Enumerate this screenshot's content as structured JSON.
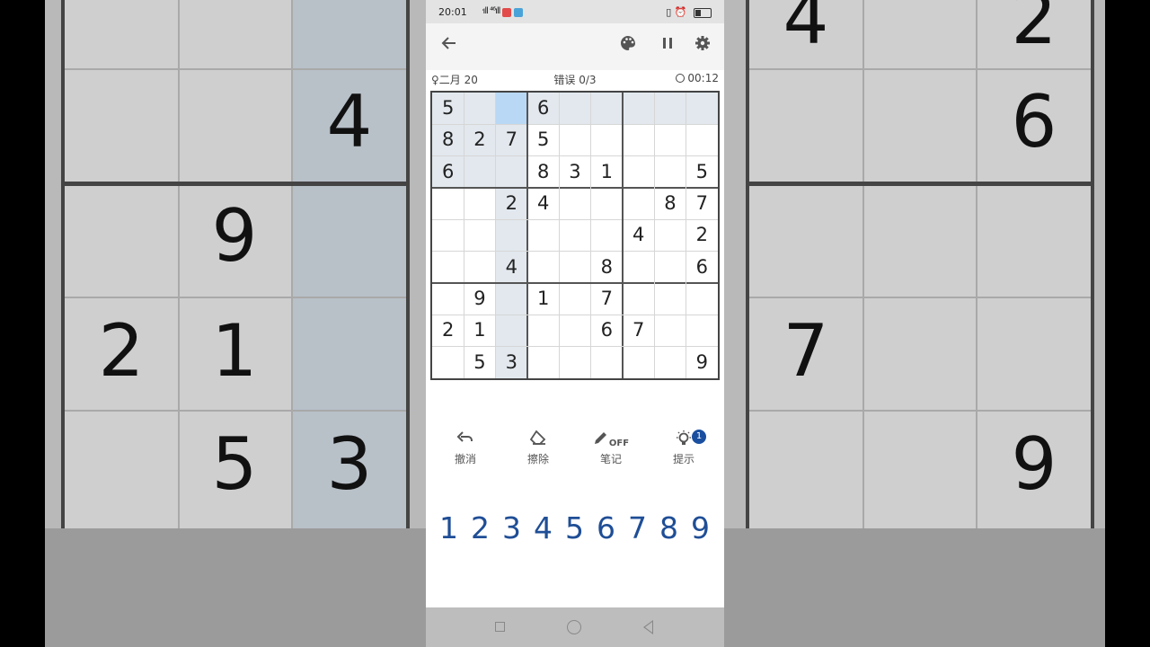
{
  "status_bar": {
    "time": "20:01",
    "signal": "ᐧıll ⁴⁶ıll"
  },
  "header": {
    "level": "二月 20",
    "mistakes": "错误 0/3",
    "timer": "00:12"
  },
  "board": {
    "grid": [
      [
        5,
        0,
        0,
        6,
        0,
        0,
        0,
        0,
        0
      ],
      [
        8,
        2,
        7,
        5,
        0,
        0,
        0,
        0,
        0
      ],
      [
        6,
        0,
        0,
        8,
        3,
        1,
        0,
        0,
        5
      ],
      [
        0,
        0,
        2,
        4,
        0,
        0,
        0,
        8,
        7
      ],
      [
        0,
        0,
        0,
        0,
        0,
        0,
        4,
        0,
        2
      ],
      [
        0,
        0,
        4,
        0,
        0,
        8,
        0,
        0,
        6
      ],
      [
        0,
        9,
        0,
        1,
        0,
        7,
        0,
        0,
        0
      ],
      [
        2,
        1,
        0,
        0,
        0,
        6,
        7,
        0,
        0
      ],
      [
        0,
        5,
        3,
        0,
        0,
        0,
        0,
        0,
        9
      ]
    ],
    "selected": [
      0,
      2
    ],
    "colors": {
      "selected": "#b9d8f5",
      "related": "#e2e8ee",
      "digit": "#222222"
    }
  },
  "actions": [
    {
      "name": "undo",
      "label": "撤消",
      "icon": "undo-icon"
    },
    {
      "name": "erase",
      "label": "擦除",
      "icon": "eraser-icon"
    },
    {
      "name": "notes",
      "label": "笔记",
      "icon": "pencil-icon",
      "toggle": "OFF"
    },
    {
      "name": "hint",
      "label": "提示",
      "icon": "lightbulb-icon",
      "badge": "1"
    }
  ],
  "numpad": [
    "1",
    "2",
    "3",
    "4",
    "5",
    "6",
    "7",
    "8",
    "9"
  ],
  "accent_color": "#1f4e96"
}
